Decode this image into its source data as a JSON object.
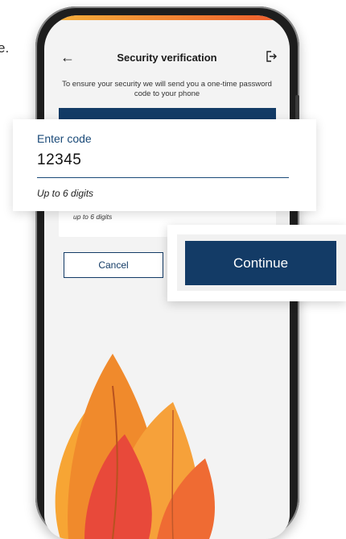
{
  "backdrop": {
    "cut_text": "e."
  },
  "header": {
    "title": "Security verification"
  },
  "description": "To ensure your security we will send you a one-time password code to your phone",
  "card": {
    "hint": "up to 6 digits"
  },
  "buttons": {
    "cancel_label": "Cancel",
    "continue_label": "Continue"
  },
  "code_input": {
    "label": "Enter code",
    "value": "12345",
    "helper": "Up to 6 digits"
  },
  "icons": {
    "back": "arrow-left-icon",
    "exit": "logout-icon"
  },
  "colors": {
    "brand_navy": "#133b66",
    "label_blue": "#1a4a78",
    "flame_orange": "#f39a2e",
    "flame_red": "#e8493a"
  }
}
